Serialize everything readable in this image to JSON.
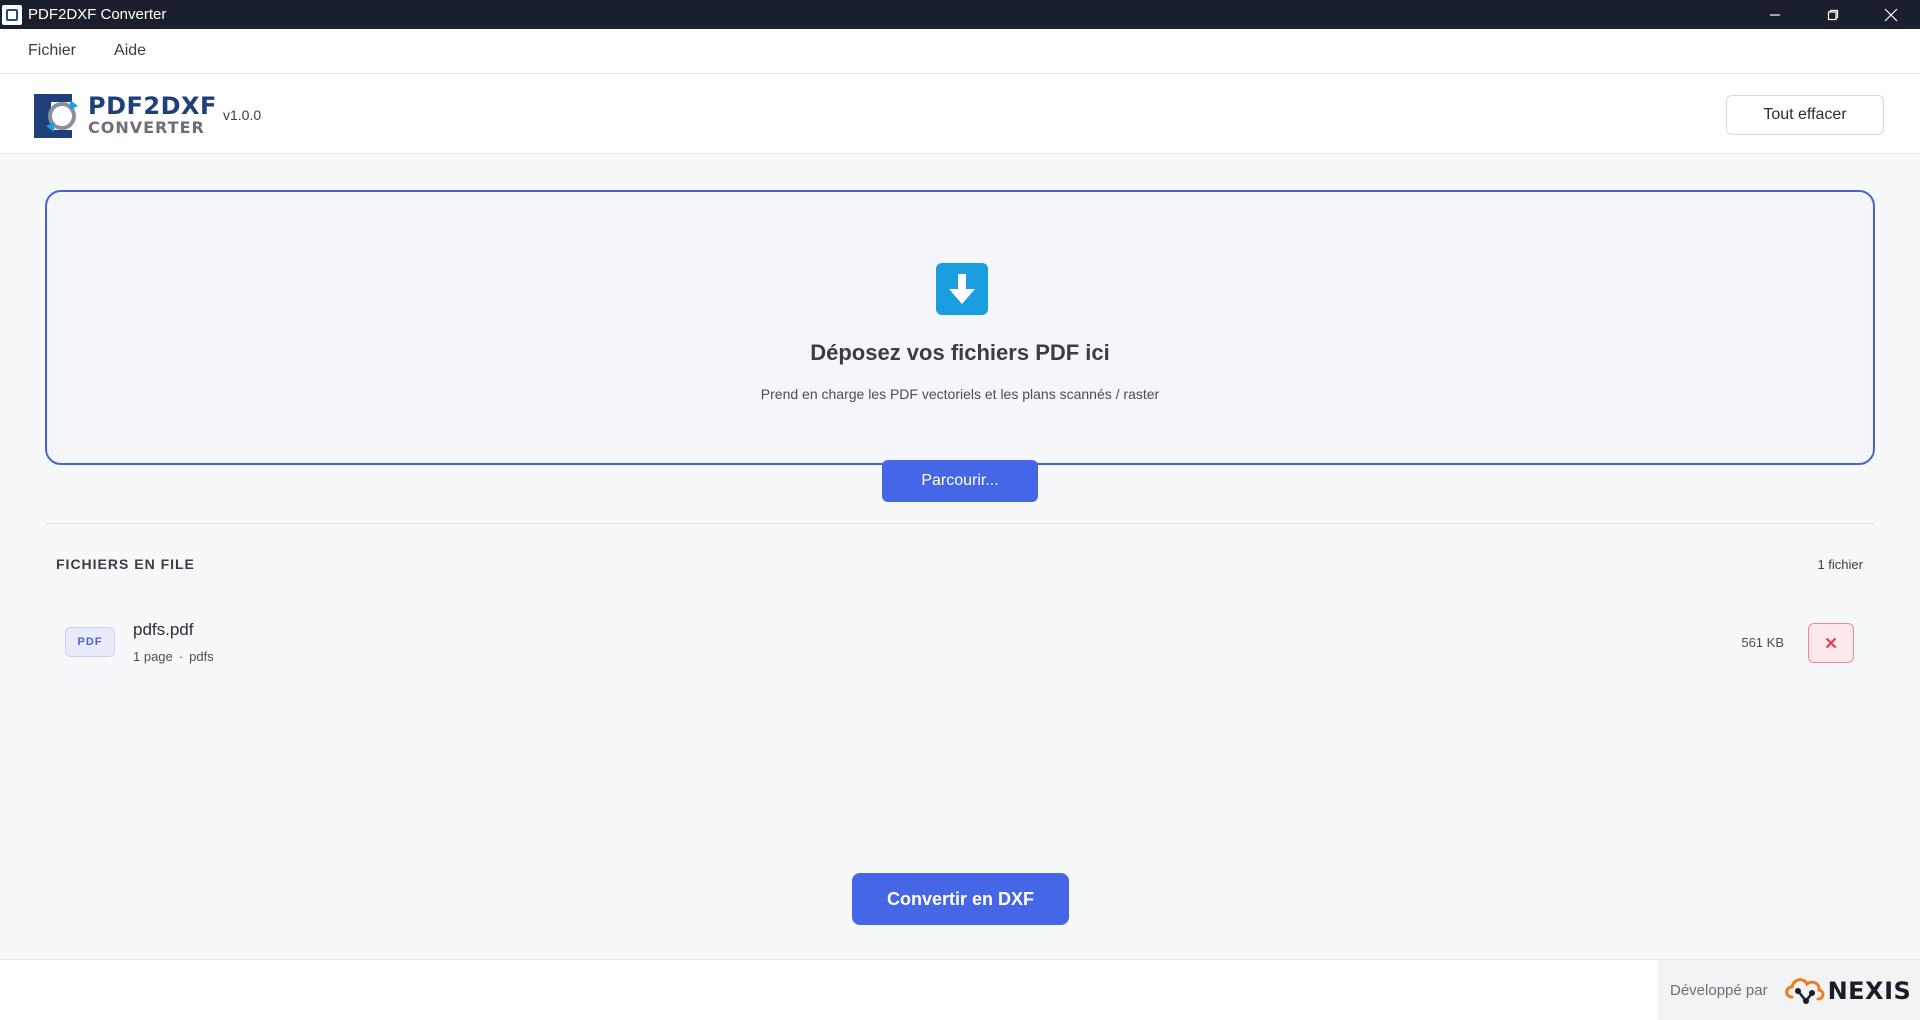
{
  "window": {
    "title": "PDF2DXF Converter"
  },
  "menu": {
    "items": [
      "Fichier",
      "Aide"
    ]
  },
  "header": {
    "logo_line1": "PDF2DXF",
    "logo_line2": "CONVERTER",
    "version": "v1.0.0",
    "clear_label": "Tout effacer"
  },
  "dropzone": {
    "icon": "download-arrow-icon",
    "title": "Déposez vos fichiers PDF ici",
    "subtitle": "Prend en charge les PDF vectoriels et les plans scannés / raster",
    "browse_label": "Parcourir..."
  },
  "queue": {
    "title": "FICHIERS EN FILE",
    "count": "1 fichier",
    "files": [
      {
        "badge": "PDF",
        "name": "pdfs.pdf",
        "pages": "1 page",
        "separator": "·",
        "folder": "pdfs",
        "size": "561 KB"
      }
    ]
  },
  "actions": {
    "convert_label": "Convertir en DXF"
  },
  "footer": {
    "by": "Développé par",
    "brand": "NEXIS"
  },
  "colors": {
    "accent": "#4566e6",
    "titlebar": "#1a1f2e",
    "drop_icon": "#1a9ee0",
    "remove": "#e8394a"
  }
}
